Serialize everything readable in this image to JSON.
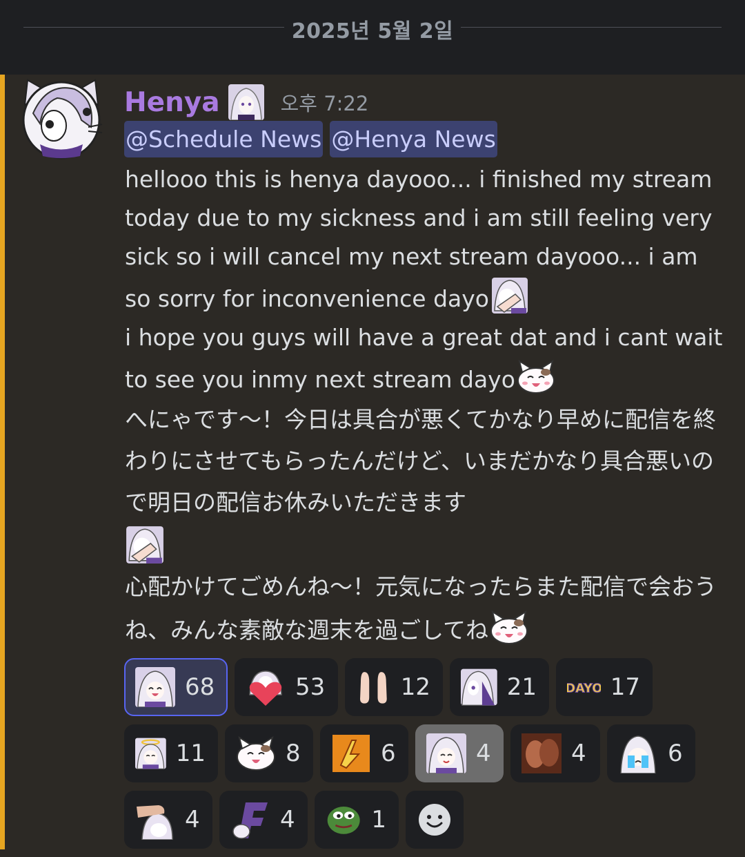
{
  "divider": {
    "date": "2025년 5월 2일"
  },
  "message": {
    "author": "Henya",
    "timestamp": "오후 7:22",
    "mentions": [
      "@Schedule News",
      "@Henya News"
    ],
    "paragraphs": {
      "p1": "hellooo this is henya dayooo... i finished my stream today due to my sickness and i am still feeling very sick so i will cancel my next stream dayooo... i am so sorry for inconvenience dayo",
      "p2": "i hope you guys will have a great dat and i cant wait to see you inmy next stream dayo",
      "p3": "へにゃです～！今日は具合が悪くてかなり早めに配信を終わりにさせてもらったんだけど、いまだかなり具合悪いので明日の配信お休みいただきます",
      "p4": "心配かけてごめんね～！元気になったらまた配信で会おうね、みんな素敵な週末を過ごしてね"
    }
  },
  "reactions": {
    "r1": {
      "icon": "henya-laugh-emoji",
      "count": "68",
      "me": true
    },
    "r2": {
      "icon": "henya-heart-emoji",
      "count": "53"
    },
    "r3": {
      "icon": "feet-emoji",
      "count": "12"
    },
    "r4": {
      "icon": "henya-peek-emoji",
      "count": "21"
    },
    "r5": {
      "icon": "dayo-text-emoji",
      "label": "DAYO",
      "count": "17"
    },
    "r6": {
      "icon": "henya-angel-emoji",
      "count": "11"
    },
    "r7": {
      "icon": "blob-cat-emoji",
      "count": "8"
    },
    "r8": {
      "icon": "orange-letter-emoji",
      "count": "6"
    },
    "r9": {
      "icon": "henya-smile-emoji",
      "count": "4",
      "highlighted": true
    },
    "r10": {
      "icon": "kiss-emoji",
      "count": "4"
    },
    "r11": {
      "icon": "henya-cry-emoji",
      "count": "6"
    },
    "r12": {
      "icon": "hand-pat-emoji",
      "count": "4"
    },
    "r13": {
      "icon": "letter-f-emoji",
      "count": "4"
    },
    "r14": {
      "icon": "pepe-emoji",
      "count": "1"
    },
    "add": {
      "icon": "add-reaction-smiley-icon"
    }
  },
  "colors": {
    "accent_bar": "#e6a521",
    "username": "#a97ae0",
    "mention_bg": "#3c4270",
    "self_reaction_border": "#5865f2"
  }
}
